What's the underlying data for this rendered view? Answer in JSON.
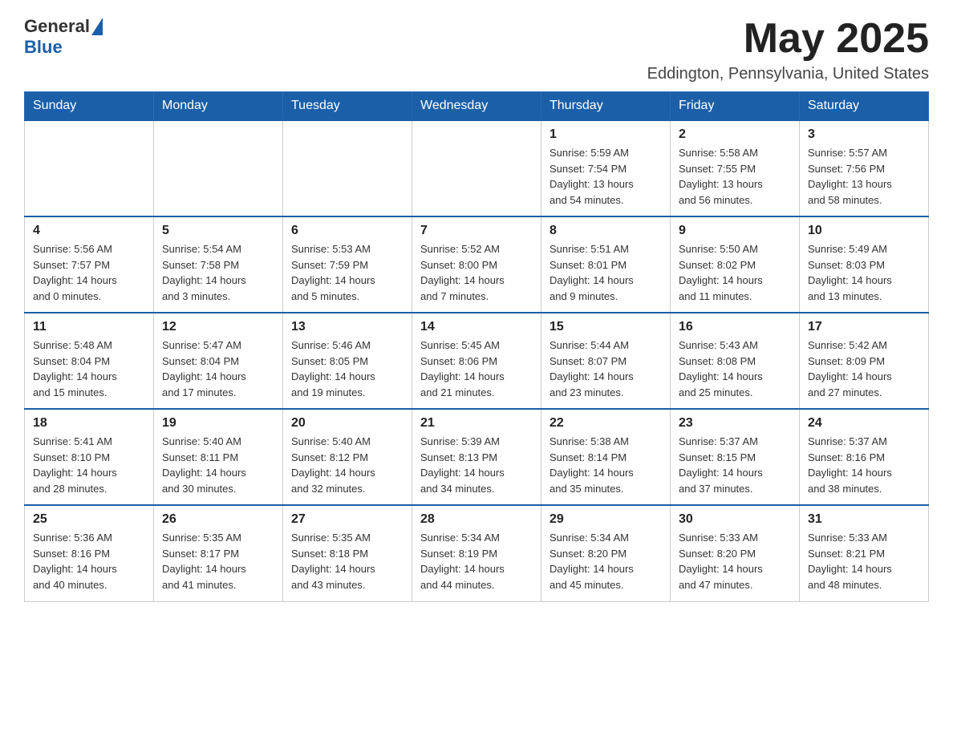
{
  "header": {
    "logo_general": "General",
    "logo_blue": "Blue",
    "title": "May 2025",
    "subtitle": "Eddington, Pennsylvania, United States"
  },
  "weekdays": [
    "Sunday",
    "Monday",
    "Tuesday",
    "Wednesday",
    "Thursday",
    "Friday",
    "Saturday"
  ],
  "weeks": [
    [
      {
        "day": "",
        "info": ""
      },
      {
        "day": "",
        "info": ""
      },
      {
        "day": "",
        "info": ""
      },
      {
        "day": "",
        "info": ""
      },
      {
        "day": "1",
        "info": "Sunrise: 5:59 AM\nSunset: 7:54 PM\nDaylight: 13 hours\nand 54 minutes."
      },
      {
        "day": "2",
        "info": "Sunrise: 5:58 AM\nSunset: 7:55 PM\nDaylight: 13 hours\nand 56 minutes."
      },
      {
        "day": "3",
        "info": "Sunrise: 5:57 AM\nSunset: 7:56 PM\nDaylight: 13 hours\nand 58 minutes."
      }
    ],
    [
      {
        "day": "4",
        "info": "Sunrise: 5:56 AM\nSunset: 7:57 PM\nDaylight: 14 hours\nand 0 minutes."
      },
      {
        "day": "5",
        "info": "Sunrise: 5:54 AM\nSunset: 7:58 PM\nDaylight: 14 hours\nand 3 minutes."
      },
      {
        "day": "6",
        "info": "Sunrise: 5:53 AM\nSunset: 7:59 PM\nDaylight: 14 hours\nand 5 minutes."
      },
      {
        "day": "7",
        "info": "Sunrise: 5:52 AM\nSunset: 8:00 PM\nDaylight: 14 hours\nand 7 minutes."
      },
      {
        "day": "8",
        "info": "Sunrise: 5:51 AM\nSunset: 8:01 PM\nDaylight: 14 hours\nand 9 minutes."
      },
      {
        "day": "9",
        "info": "Sunrise: 5:50 AM\nSunset: 8:02 PM\nDaylight: 14 hours\nand 11 minutes."
      },
      {
        "day": "10",
        "info": "Sunrise: 5:49 AM\nSunset: 8:03 PM\nDaylight: 14 hours\nand 13 minutes."
      }
    ],
    [
      {
        "day": "11",
        "info": "Sunrise: 5:48 AM\nSunset: 8:04 PM\nDaylight: 14 hours\nand 15 minutes."
      },
      {
        "day": "12",
        "info": "Sunrise: 5:47 AM\nSunset: 8:04 PM\nDaylight: 14 hours\nand 17 minutes."
      },
      {
        "day": "13",
        "info": "Sunrise: 5:46 AM\nSunset: 8:05 PM\nDaylight: 14 hours\nand 19 minutes."
      },
      {
        "day": "14",
        "info": "Sunrise: 5:45 AM\nSunset: 8:06 PM\nDaylight: 14 hours\nand 21 minutes."
      },
      {
        "day": "15",
        "info": "Sunrise: 5:44 AM\nSunset: 8:07 PM\nDaylight: 14 hours\nand 23 minutes."
      },
      {
        "day": "16",
        "info": "Sunrise: 5:43 AM\nSunset: 8:08 PM\nDaylight: 14 hours\nand 25 minutes."
      },
      {
        "day": "17",
        "info": "Sunrise: 5:42 AM\nSunset: 8:09 PM\nDaylight: 14 hours\nand 27 minutes."
      }
    ],
    [
      {
        "day": "18",
        "info": "Sunrise: 5:41 AM\nSunset: 8:10 PM\nDaylight: 14 hours\nand 28 minutes."
      },
      {
        "day": "19",
        "info": "Sunrise: 5:40 AM\nSunset: 8:11 PM\nDaylight: 14 hours\nand 30 minutes."
      },
      {
        "day": "20",
        "info": "Sunrise: 5:40 AM\nSunset: 8:12 PM\nDaylight: 14 hours\nand 32 minutes."
      },
      {
        "day": "21",
        "info": "Sunrise: 5:39 AM\nSunset: 8:13 PM\nDaylight: 14 hours\nand 34 minutes."
      },
      {
        "day": "22",
        "info": "Sunrise: 5:38 AM\nSunset: 8:14 PM\nDaylight: 14 hours\nand 35 minutes."
      },
      {
        "day": "23",
        "info": "Sunrise: 5:37 AM\nSunset: 8:15 PM\nDaylight: 14 hours\nand 37 minutes."
      },
      {
        "day": "24",
        "info": "Sunrise: 5:37 AM\nSunset: 8:16 PM\nDaylight: 14 hours\nand 38 minutes."
      }
    ],
    [
      {
        "day": "25",
        "info": "Sunrise: 5:36 AM\nSunset: 8:16 PM\nDaylight: 14 hours\nand 40 minutes."
      },
      {
        "day": "26",
        "info": "Sunrise: 5:35 AM\nSunset: 8:17 PM\nDaylight: 14 hours\nand 41 minutes."
      },
      {
        "day": "27",
        "info": "Sunrise: 5:35 AM\nSunset: 8:18 PM\nDaylight: 14 hours\nand 43 minutes."
      },
      {
        "day": "28",
        "info": "Sunrise: 5:34 AM\nSunset: 8:19 PM\nDaylight: 14 hours\nand 44 minutes."
      },
      {
        "day": "29",
        "info": "Sunrise: 5:34 AM\nSunset: 8:20 PM\nDaylight: 14 hours\nand 45 minutes."
      },
      {
        "day": "30",
        "info": "Sunrise: 5:33 AM\nSunset: 8:20 PM\nDaylight: 14 hours\nand 47 minutes."
      },
      {
        "day": "31",
        "info": "Sunrise: 5:33 AM\nSunset: 8:21 PM\nDaylight: 14 hours\nand 48 minutes."
      }
    ]
  ]
}
